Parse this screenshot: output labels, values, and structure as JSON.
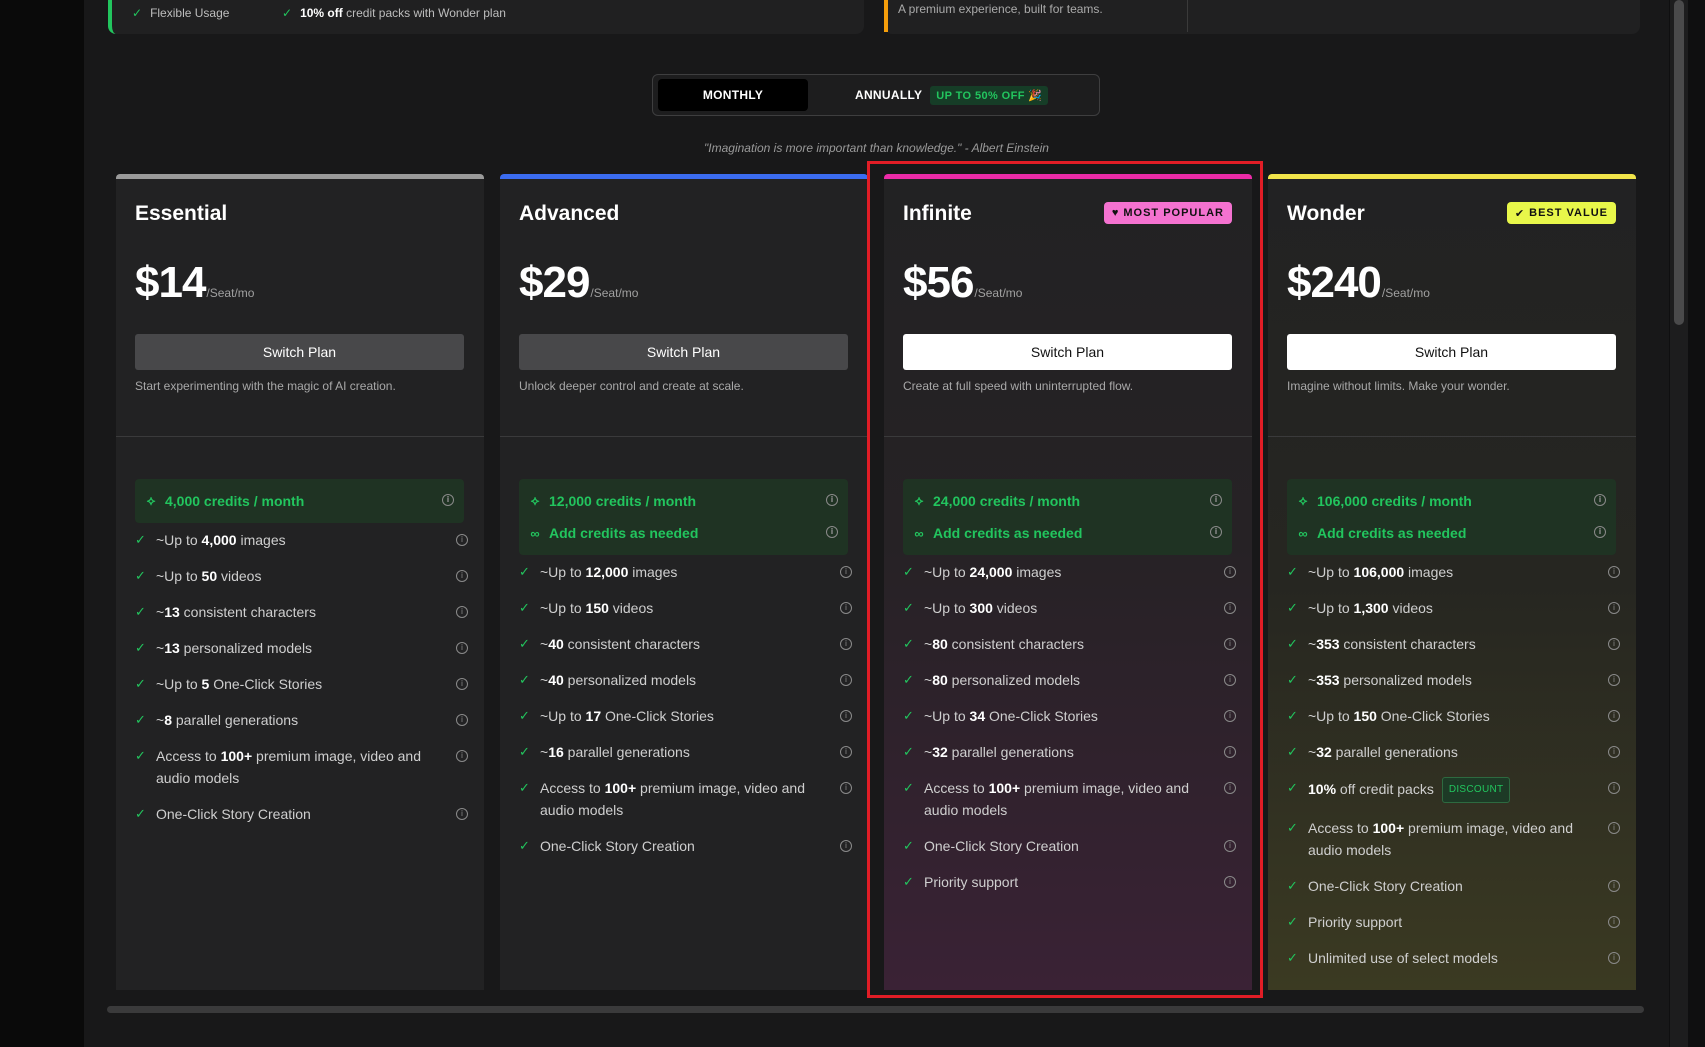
{
  "top": {
    "feature_flexible": "Flexible Usage",
    "feature_discount_bold": "10% off",
    "feature_discount_rest": "credit packs with Wonder plan",
    "team_subtitle": "A premium experience, built for teams."
  },
  "billing_toggle": {
    "monthly": "MONTHLY",
    "annually": "ANNUALLY",
    "discount": "UP TO 50% OFF 🎉"
  },
  "quote": "\"Imagination is more important than knowledge.\" - Albert Einstein",
  "colors": {
    "essential": "#9a9a9a",
    "advanced": "#3b6cf0",
    "infinite": "#ec2ba8",
    "wonder": "#f1e44a",
    "accent_green": "#22c55e",
    "highlight": "#e11d26"
  },
  "plans": [
    {
      "name": "Essential",
      "price": "$14",
      "per": "/Seat/mo",
      "button": "Switch Plan",
      "tagline": "Start experimenting with the magic of AI creation.",
      "credits": "4,000 credits / month",
      "features": [
        {
          "pre": "~Up to ",
          "b": "4,000",
          "post": " images"
        },
        {
          "pre": "~Up to ",
          "b": "50",
          "post": " videos"
        },
        {
          "pre": "~",
          "b": "13",
          "post": " consistent characters"
        },
        {
          "pre": "~",
          "b": "13",
          "post": " personalized models"
        },
        {
          "pre": "~Up to ",
          "b": "5",
          "post": " One-Click Stories"
        },
        {
          "pre": "~",
          "b": "8",
          "post": " parallel generations"
        },
        {
          "pre": "Access to ",
          "b": "100+",
          "post": " premium image, video and audio models"
        },
        {
          "pre": "",
          "b": "",
          "post": "One-Click Story Creation"
        }
      ]
    },
    {
      "name": "Advanced",
      "price": "$29",
      "per": "/Seat/mo",
      "button": "Switch Plan",
      "tagline": "Unlock deeper control and create at scale.",
      "credits": "12,000 credits / month",
      "add_credits": "Add credits as needed",
      "features": [
        {
          "pre": "~Up to ",
          "b": "12,000",
          "post": " images"
        },
        {
          "pre": "~Up to ",
          "b": "150",
          "post": " videos"
        },
        {
          "pre": "~",
          "b": "40",
          "post": " consistent characters"
        },
        {
          "pre": "~",
          "b": "40",
          "post": " personalized models"
        },
        {
          "pre": "~Up to ",
          "b": "17",
          "post": " One-Click Stories"
        },
        {
          "pre": "~",
          "b": "16",
          "post": " parallel generations"
        },
        {
          "pre": "Access to ",
          "b": "100+",
          "post": " premium image, video and audio models"
        },
        {
          "pre": "",
          "b": "",
          "post": "One-Click Story Creation"
        }
      ]
    },
    {
      "name": "Infinite",
      "price": "$56",
      "per": "/Seat/mo",
      "button": "Switch Plan",
      "badge": "MOST POPULAR",
      "tagline": "Create at full speed with uninterrupted flow.",
      "credits": "24,000 credits / month",
      "add_credits": "Add credits as needed",
      "features": [
        {
          "pre": "~Up to ",
          "b": "24,000",
          "post": " images"
        },
        {
          "pre": "~Up to ",
          "b": "300",
          "post": " videos"
        },
        {
          "pre": "~",
          "b": "80",
          "post": " consistent characters"
        },
        {
          "pre": "~",
          "b": "80",
          "post": " personalized models"
        },
        {
          "pre": "~Up to ",
          "b": "34",
          "post": " One-Click Stories"
        },
        {
          "pre": "~",
          "b": "32",
          "post": " parallel generations"
        },
        {
          "pre": "Access to ",
          "b": "100+",
          "post": " premium image, video and audio models"
        },
        {
          "pre": "",
          "b": "",
          "post": "One-Click Story Creation"
        },
        {
          "pre": "",
          "b": "",
          "post": "Priority support"
        }
      ]
    },
    {
      "name": "Wonder",
      "price": "$240",
      "per": "/Seat/mo",
      "button": "Switch Plan",
      "badge": "BEST VALUE",
      "tagline": "Imagine without limits. Make your wonder.",
      "credits": "106,000 credits / month",
      "add_credits": "Add credits as needed",
      "features": [
        {
          "pre": "~Up to ",
          "b": "106,000",
          "post": " images"
        },
        {
          "pre": "~Up to ",
          "b": "1,300",
          "post": " videos"
        },
        {
          "pre": "~",
          "b": "353",
          "post": " consistent characters"
        },
        {
          "pre": "~",
          "b": "353",
          "post": " personalized models"
        },
        {
          "pre": "~Up to ",
          "b": "150",
          "post": " One-Click Stories"
        },
        {
          "pre": "~",
          "b": "32",
          "post": " parallel generations"
        },
        {
          "pre": "",
          "b": "10%",
          "post": " off credit packs",
          "tag": "DISCOUNT"
        },
        {
          "pre": "Access to ",
          "b": "100+",
          "post": " premium image, video and audio models"
        },
        {
          "pre": "",
          "b": "",
          "post": "One-Click Story Creation"
        },
        {
          "pre": "",
          "b": "",
          "post": "Priority support"
        },
        {
          "pre": "",
          "b": "",
          "post": "Unlimited use of select models"
        }
      ]
    }
  ]
}
